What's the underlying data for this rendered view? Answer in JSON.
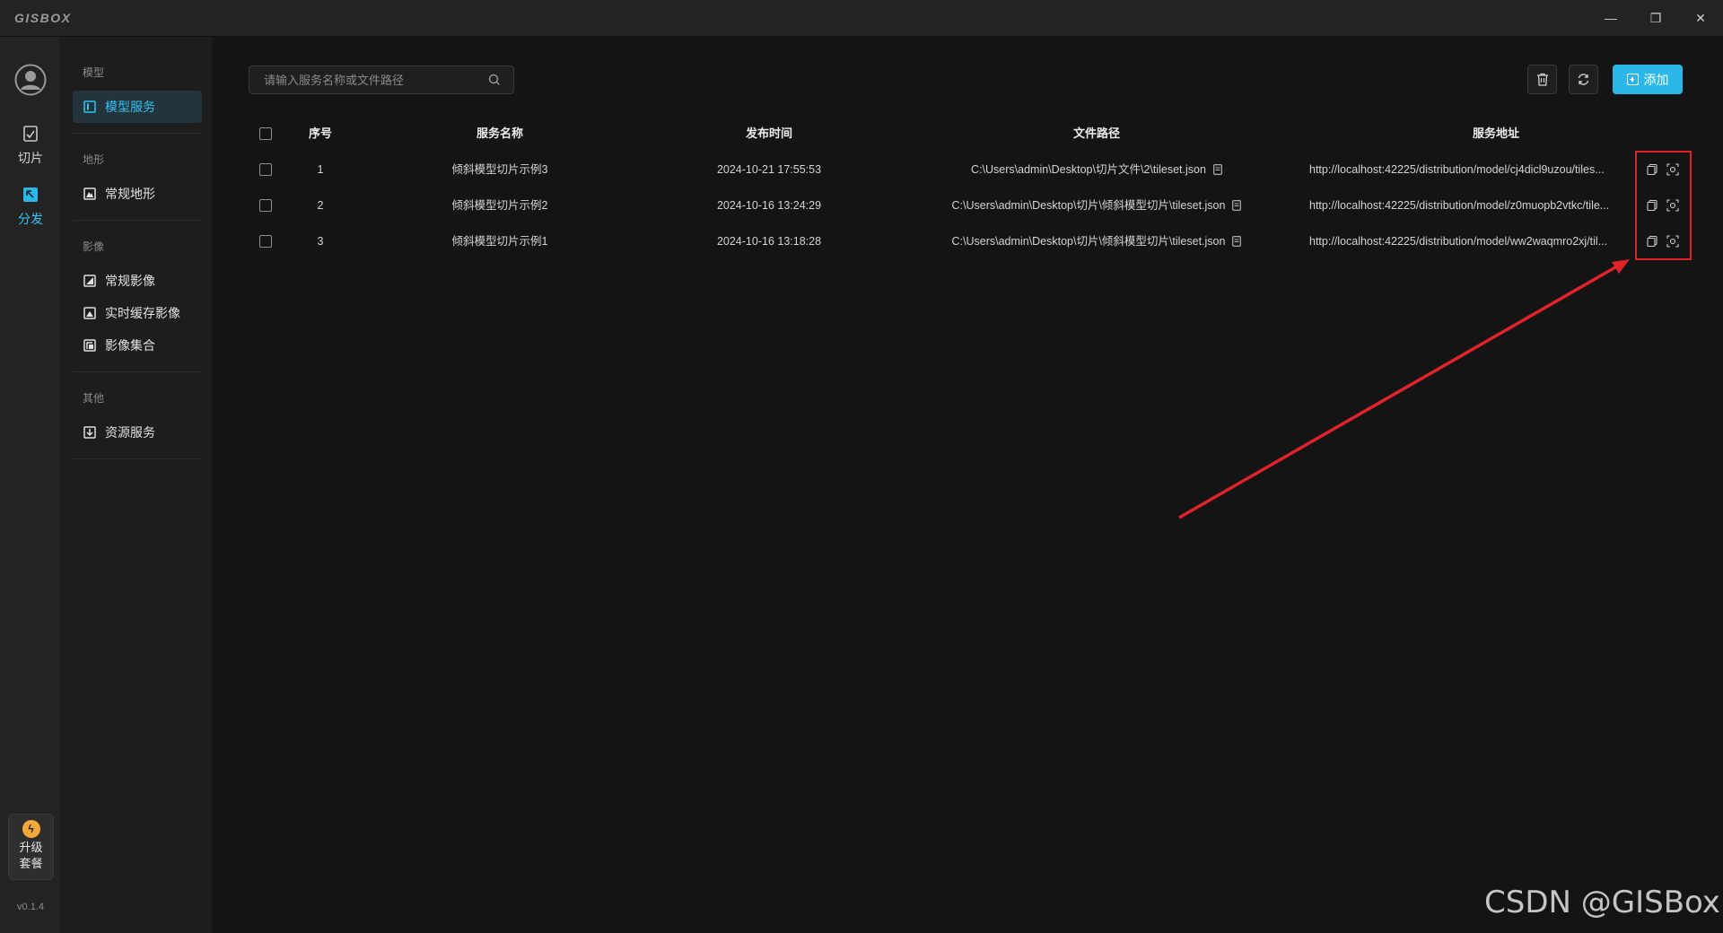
{
  "app": {
    "logo": "GISBOX"
  },
  "window_controls": {
    "minimize": "—",
    "restore": "❐",
    "close": "✕"
  },
  "rail": {
    "items": [
      {
        "label": "切片",
        "icon": "slice-icon"
      },
      {
        "label": "分发",
        "icon": "distribute-icon",
        "active": true
      }
    ],
    "upgrade": {
      "line1": "升级",
      "line2": "套餐"
    },
    "version": "v0.1.4"
  },
  "nav": {
    "groups": [
      {
        "title": "模型",
        "items": [
          {
            "label": "模型服务",
            "active": true
          }
        ]
      },
      {
        "title": "地形",
        "items": [
          {
            "label": "常规地形"
          }
        ]
      },
      {
        "title": "影像",
        "items": [
          {
            "label": "常规影像"
          },
          {
            "label": "实时缓存影像"
          },
          {
            "label": "影像集合"
          }
        ]
      },
      {
        "title": "其他",
        "items": [
          {
            "label": "资源服务"
          }
        ]
      }
    ]
  },
  "toolbar": {
    "search_placeholder": "请输入服务名称或文件路径",
    "add_label": "添加"
  },
  "table": {
    "headers": {
      "index": "序号",
      "name": "服务名称",
      "time": "发布时间",
      "path": "文件路径",
      "url": "服务地址"
    },
    "rows": [
      {
        "index": "1",
        "name": "倾斜模型切片示例3",
        "time": "2024-10-21 17:55:53",
        "path": "C:\\Users\\admin\\Desktop\\切片文件\\2\\tileset.json",
        "url": "http://localhost:42225/distribution/model/cj4dicl9uzou/tiles..."
      },
      {
        "index": "2",
        "name": "倾斜模型切片示例2",
        "time": "2024-10-16 13:24:29",
        "path": "C:\\Users\\admin\\Desktop\\切片\\倾斜模型切片\\tileset.json",
        "url": "http://localhost:42225/distribution/model/z0muopb2vtkc/tile..."
      },
      {
        "index": "3",
        "name": "倾斜模型切片示例1",
        "time": "2024-10-16 13:18:28",
        "path": "C:\\Users\\admin\\Desktop\\切片\\倾斜模型切片\\tileset.json",
        "url": "http://localhost:42225/distribution/model/ww2waqmro2xj/til..."
      }
    ]
  },
  "colors": {
    "accent": "#2bb7e8",
    "highlight": "#e0222a",
    "background": "#141414"
  },
  "watermark": "CSDN @GISBox"
}
